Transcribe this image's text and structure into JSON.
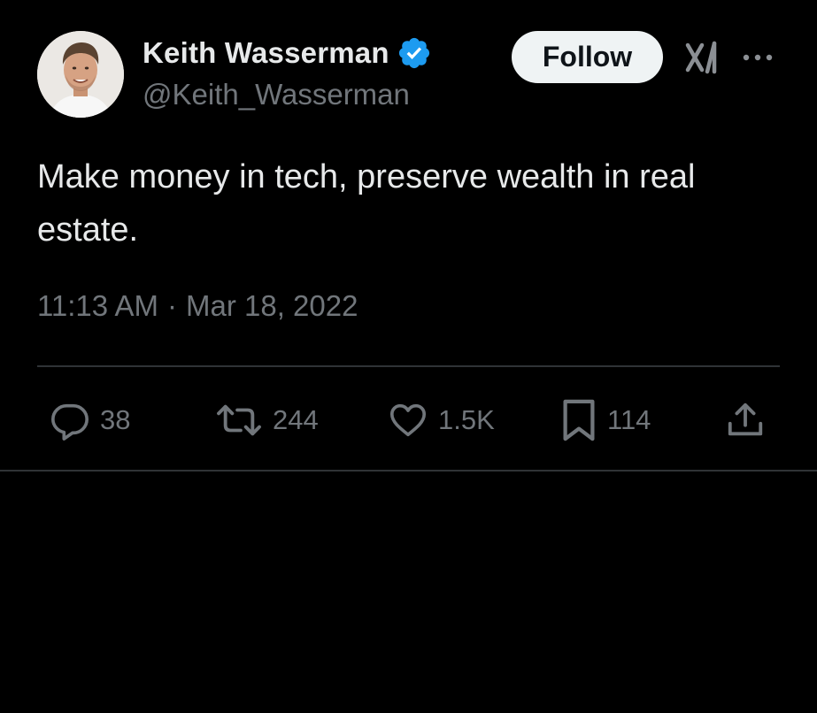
{
  "author": {
    "display_name": "Keith Wasserman",
    "handle": "@Keith_Wasserman",
    "verified": true,
    "verified_color": "#1d9bf0"
  },
  "header": {
    "follow_label": "Follow",
    "grok_icon": "grok-icon",
    "more_icon": "more-icon"
  },
  "tweet": {
    "text": "Make money in tech, preserve wealth in real estate.",
    "time": "11:13 AM",
    "separator": "·",
    "date": "Mar 18, 2022"
  },
  "actions": {
    "reply": {
      "icon": "reply-icon",
      "count": "38"
    },
    "retweet": {
      "icon": "retweet-icon",
      "count": "244"
    },
    "like": {
      "icon": "heart-icon",
      "count": "1.5K"
    },
    "bookmark": {
      "icon": "bookmark-icon",
      "count": "114"
    },
    "share": {
      "icon": "share-icon"
    }
  },
  "colors": {
    "background": "#000000",
    "primary_text": "#e7e9ea",
    "secondary_text": "#71767b",
    "divider": "#2f3336",
    "follow_bg": "#eff3f4"
  }
}
